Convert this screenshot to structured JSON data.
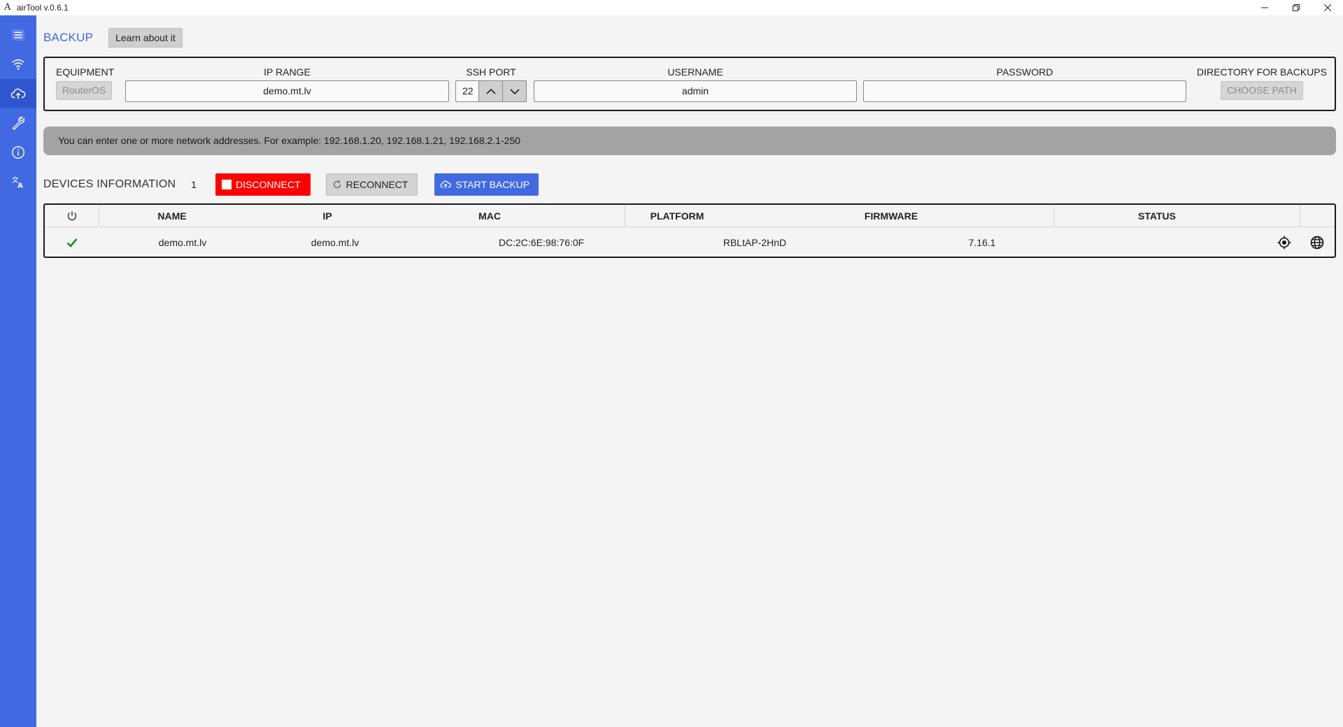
{
  "window": {
    "title": "airTool v.0.6.1",
    "logo_char": "A",
    "controls": {
      "minimize": "—",
      "restore": "❐",
      "close": "✕"
    }
  },
  "sidebar": {
    "items": [
      {
        "icon": "menu-icon",
        "active": false
      },
      {
        "icon": "wifi-icon",
        "active": false
      },
      {
        "icon": "cloud-upload-icon",
        "active": true
      },
      {
        "icon": "wrench-icon",
        "active": false
      },
      {
        "icon": "info-icon",
        "active": false
      },
      {
        "icon": "translate-icon",
        "active": false
      }
    ]
  },
  "header": {
    "title": "BACKUP",
    "learn_button": "Learn about it"
  },
  "settings": {
    "equipment": {
      "label": "EQUIPMENT",
      "value": "RouterOS"
    },
    "ip_range": {
      "label": "IP RANGE",
      "value": "demo.mt.lv"
    },
    "ssh_port": {
      "label": "SSH PORT",
      "value": "22"
    },
    "username": {
      "label": "USERNAME",
      "value": "admin"
    },
    "password": {
      "label": "PASSWORD",
      "value": ""
    },
    "directory": {
      "label": "DIRECTORY FOR BACKUPS",
      "button": "CHOOSE PATH"
    }
  },
  "info_bar": {
    "text": "You can enter one or more network addresses. For example: 192.168.1.20, 192.168.1.21, 192.168.2.1-250"
  },
  "devices": {
    "title": "DEVICES INFORMATION",
    "count": "1",
    "disconnect_label": "DISCONNECT",
    "reconnect_label": "RECONNECT",
    "start_backup_label": "START BACKUP"
  },
  "table": {
    "columns": [
      "NAME",
      "IP",
      "MAC",
      "PLATFORM",
      "FIRMWARE",
      "STATUS"
    ],
    "rows": [
      {
        "connected": true,
        "name": "demo.mt.lv",
        "ip": "demo.mt.lv",
        "mac": "DC:2C:6E:98:76:0F",
        "platform": "RBLtAP-2HnD",
        "firmware": "7.16.1",
        "status": ""
      }
    ]
  },
  "colors": {
    "accent": "#4169e1",
    "danger": "#ff0000",
    "success": "#1a8a1a",
    "info_bar": "#a3a3a3"
  }
}
